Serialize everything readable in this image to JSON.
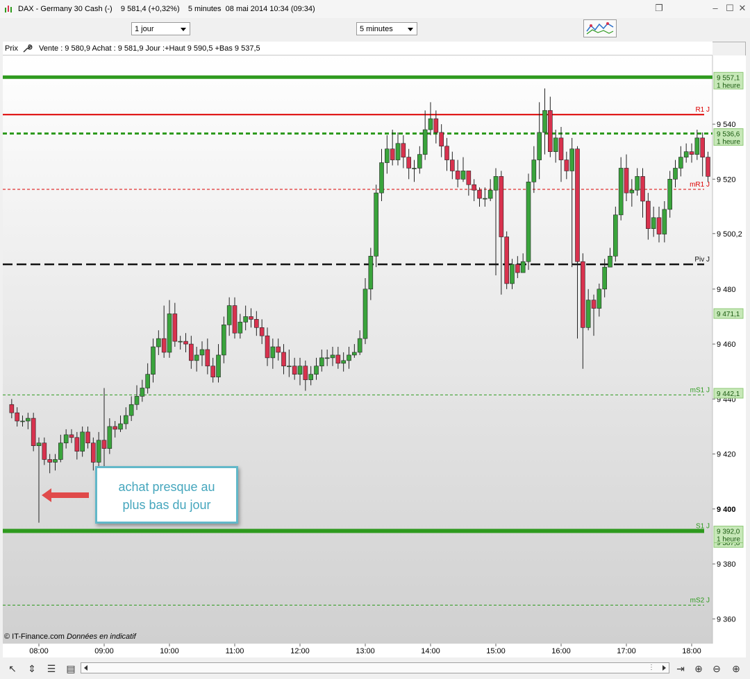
{
  "window": {
    "title": "DAX - Germany 30 Cash (-)    9 581,4 (+0,32%)    5 minutes  08 mai 2014 10:34 (09:34)",
    "controls": [
      "restore",
      "minimize",
      "maximize",
      "close"
    ]
  },
  "toolbar": {
    "period_select": "1 jour",
    "interval_select": "5 minutes"
  },
  "infobar": {
    "label": "Prix",
    "quote": "Vente : 9 580,9 Achat : 9 581,9 Jour :+Haut 9 590,5 +Bas 9 537,5"
  },
  "annotation": {
    "line1": "achat presque au",
    "line2": "plus bas du jour"
  },
  "copyright": {
    "source": "© IT-Finance.com",
    "note": "Données en indicatif"
  },
  "colors": {
    "up": "#3aa43c",
    "down": "#d8324e",
    "resistance": "#dd0000",
    "support": "#2e9a1e",
    "pivot": "#111111",
    "annotation_border": "#62b8c9",
    "annotation_text": "#45a6bd",
    "arrow": "#e04a4a"
  },
  "chart_data": {
    "type": "candlestick",
    "instrument": "DAX - Germany 30 Cash (-)",
    "interval": "5 minutes",
    "x_tick_labels": [
      "08:00",
      "09:00",
      "10:00",
      "11:00",
      "12:00",
      "13:00",
      "14:00",
      "15:00",
      "16:00",
      "17:00",
      "18:00"
    ],
    "y_tick_labels": [
      "9 360",
      "9 380",
      "9 400",
      "9 420",
      "9 440",
      "9 460",
      "9 480",
      "9 500,2",
      "9 520",
      "9 540"
    ],
    "ylim": [
      9351,
      9565
    ],
    "levels": [
      {
        "label": "R1 J",
        "value": 9543.5,
        "style": "solid",
        "color": "#dd0000"
      },
      {
        "label": "mR1 J",
        "value": 9516.3,
        "style": "dashed",
        "color": "#dd0000"
      },
      {
        "label": "Piv J",
        "value": 9489.0,
        "style": "dashed",
        "color": "#111111"
      },
      {
        "label": "mS1 J",
        "value": 9441.5,
        "style": "dashed",
        "color": "#2e9a1e"
      },
      {
        "label": "S1 J",
        "value": 9392.0,
        "style": "solid",
        "color": "#2e9a1e"
      },
      {
        "label": "mS2 J",
        "value": 9365.0,
        "style": "dashed",
        "color": "#2e9a1e"
      }
    ],
    "hour_levels": [
      {
        "value": 9557.1,
        "label": "9 557,1",
        "sub": "1 heure",
        "style": "solid"
      },
      {
        "value": 9536.6,
        "label": "9 536,6",
        "sub": "1 heure",
        "style": "dashed"
      },
      {
        "value": 9392.0,
        "label": "9 392,0",
        "sub": "1 heure",
        "style": "solid"
      }
    ],
    "price_tags": [
      {
        "value": 9471.1,
        "label": "9 471,1"
      },
      {
        "value": 9442.1,
        "label": "9 442,1"
      },
      {
        "value": 9387.8,
        "label": "9 387,8"
      }
    ],
    "series": [
      {
        "name": "DAX",
        "time": [
          "07:35",
          "07:40",
          "07:45",
          "07:50",
          "07:55",
          "08:00",
          "08:05",
          "08:10",
          "08:15",
          "08:20",
          "08:25",
          "08:30",
          "08:35",
          "08:40",
          "08:45",
          "08:50",
          "08:55",
          "09:00",
          "09:05",
          "09:10",
          "09:15",
          "09:20",
          "09:25",
          "09:30",
          "09:35",
          "09:40",
          "09:45",
          "09:50",
          "09:55",
          "10:00",
          "10:05",
          "10:10",
          "10:15",
          "10:20",
          "10:25",
          "10:30",
          "10:35",
          "10:40",
          "10:45",
          "10:50",
          "10:55",
          "11:00",
          "11:05",
          "11:10",
          "11:15",
          "11:20",
          "11:25",
          "11:30",
          "11:35",
          "11:40",
          "11:45",
          "11:50",
          "11:55",
          "12:00",
          "12:05",
          "12:10",
          "12:15",
          "12:20",
          "12:25",
          "12:30",
          "12:35",
          "12:40",
          "12:45",
          "12:50",
          "12:55",
          "13:00",
          "13:05",
          "13:10",
          "13:15",
          "13:20",
          "13:25",
          "13:30",
          "13:35",
          "13:40",
          "13:45",
          "13:50",
          "13:55",
          "14:00",
          "14:05",
          "14:10",
          "14:15",
          "14:20",
          "14:25",
          "14:30",
          "14:35",
          "14:40",
          "14:45",
          "14:50",
          "14:55",
          "15:00",
          "15:05",
          "15:10",
          "15:15",
          "15:20",
          "15:25",
          "15:30",
          "15:35",
          "15:40",
          "15:45",
          "15:50",
          "15:55",
          "16:00",
          "16:05",
          "16:10",
          "16:15",
          "16:20",
          "16:25",
          "16:30",
          "16:35",
          "16:40",
          "16:45",
          "16:50",
          "16:55",
          "17:00",
          "17:05",
          "17:10",
          "17:15",
          "17:20",
          "17:25",
          "17:30",
          "17:35",
          "17:40",
          "17:45",
          "17:50",
          "17:55",
          "18:00",
          "18:05",
          "18:10",
          "18:15"
        ],
        "open": [
          9438,
          9435,
          9432,
          9432,
          9433,
          9423,
          9424,
          9418,
          9417,
          9418,
          9424,
          9427,
          9426,
          9421,
          9428,
          9424,
          9417,
          9425,
          9422,
          9430,
          9429,
          9431,
          9434,
          9438,
          9441,
          9444,
          9449,
          9459,
          9462,
          9457,
          9471,
          9461,
          9461,
          9460,
          9454,
          9456,
          9458,
          9452,
          9448,
          9456,
          9467,
          9474,
          9464,
          9468,
          9470,
          9469,
          9466,
          9463,
          9455,
          9459,
          9457,
          9452,
          9452,
          9449,
          9452,
          9447,
          9449,
          9452,
          9455,
          9455,
          9456,
          9453,
          9454,
          9456,
          9457,
          9462,
          9480,
          9492,
          9515,
          9526,
          9531,
          9527,
          9533,
          9528,
          9524,
          9524,
          9529,
          9538,
          9542,
          9537,
          9532,
          9527,
          9523,
          9520,
          9523,
          9518,
          9516,
          9513,
          9513,
          9516,
          9521,
          9499,
          9482,
          9489,
          9486,
          9490,
          9519,
          9527,
          9537,
          9545,
          9530,
          9535,
          9527,
          9523,
          9531,
          9490,
          9466,
          9476,
          9473,
          9480,
          9488,
          9492,
          9507,
          9524,
          9515,
          9516,
          9521,
          9512,
          9502,
          9506,
          9500,
          9509,
          9520,
          9524,
          9528,
          9530,
          9529,
          9535,
          9528,
          9521,
          9525
        ],
        "close": [
          9435,
          9432,
          9432,
          9433,
          9423,
          9424,
          9418,
          9417,
          9418,
          9424,
          9427,
          9426,
          9421,
          9428,
          9424,
          9417,
          9425,
          9422,
          9430,
          9429,
          9431,
          9434,
          9438,
          9441,
          9444,
          9449,
          9459,
          9462,
          9457,
          9471,
          9461,
          9461,
          9460,
          9454,
          9456,
          9458,
          9452,
          9448,
          9456,
          9467,
          9474,
          9464,
          9468,
          9470,
          9469,
          9466,
          9463,
          9455,
          9459,
          9457,
          9452,
          9452,
          9449,
          9452,
          9447,
          9449,
          9452,
          9455,
          9455,
          9456,
          9453,
          9454,
          9456,
          9457,
          9462,
          9480,
          9492,
          9515,
          9526,
          9531,
          9527,
          9533,
          9528,
          9524,
          9524,
          9529,
          9538,
          9542,
          9537,
          9532,
          9527,
          9523,
          9520,
          9523,
          9518,
          9516,
          9513,
          9513,
          9516,
          9521,
          9499,
          9482,
          9489,
          9486,
          9490,
          9519,
          9527,
          9537,
          9545,
          9530,
          9535,
          9527,
          9523,
          9531,
          9490,
          9466,
          9476,
          9473,
          9480,
          9488,
          9492,
          9507,
          9524,
          9515,
          9516,
          9521,
          9512,
          9502,
          9506,
          9500,
          9509,
          9520,
          9524,
          9528,
          9530,
          9529,
          9535,
          9528,
          9521,
          9525,
          9530
        ],
        "high": [
          9440,
          9437,
          9434,
          9435,
          9435,
          9426,
          9426,
          9420,
          9420,
          9427,
          9429,
          9429,
          9428,
          9430,
          9430,
          9426,
          9428,
          9444,
          9433,
          9432,
          9434,
          9437,
          9441,
          9445,
          9447,
          9453,
          9462,
          9465,
          9474,
          9476,
          9475,
          9463,
          9464,
          9463,
          9459,
          9461,
          9462,
          9455,
          9460,
          9470,
          9477,
          9477,
          9471,
          9474,
          9473,
          9472,
          9469,
          9466,
          9462,
          9462,
          9460,
          9458,
          9455,
          9455,
          9454,
          9452,
          9455,
          9458,
          9458,
          9459,
          9459,
          9457,
          9459,
          9460,
          9465,
          9484,
          9495,
          9518,
          9531,
          9536,
          9538,
          9537,
          9536,
          9531,
          9527,
          9532,
          9545,
          9548,
          9545,
          9540,
          9535,
          9530,
          9527,
          9528,
          9522,
          9520,
          9517,
          9517,
          9520,
          9524,
          9523,
          9501,
          9491,
          9492,
          9493,
          9522,
          9532,
          9548,
          9553,
          9550,
          9538,
          9539,
          9530,
          9535,
          9532,
          9493,
          9480,
          9478,
          9482,
          9491,
          9495,
          9510,
          9528,
          9529,
          9520,
          9524,
          9524,
          9515,
          9510,
          9510,
          9512,
          9523,
          9527,
          9532,
          9533,
          9533,
          9538,
          9537,
          9530,
          9528,
          9534
        ],
        "low": [
          9433,
          9430,
          9430,
          9429,
          9421,
          9395,
          9416,
          9413,
          9414,
          9417,
          9422,
          9424,
          9418,
          9419,
          9422,
          9414,
          9414,
          9409,
          9420,
          9426,
          9428,
          9429,
          9432,
          9436,
          9439,
          9442,
          9446,
          9456,
          9455,
          9455,
          9459,
          9458,
          9457,
          9451,
          9450,
          9452,
          9449,
          9446,
          9446,
          9453,
          9463,
          9462,
          9462,
          9465,
          9466,
          9463,
          9460,
          9452,
          9451,
          9454,
          9449,
          9448,
          9447,
          9445,
          9443,
          9445,
          9447,
          9450,
          9452,
          9452,
          9451,
          9450,
          9451,
          9455,
          9456,
          9460,
          9476,
          9488,
          9512,
          9522,
          9525,
          9525,
          9524,
          9520,
          9519,
          9522,
          9527,
          9536,
          9533,
          9528,
          9523,
          9520,
          9517,
          9519,
          9514,
          9512,
          9510,
          9510,
          9512,
          9485,
          9478,
          9480,
          9480,
          9484,
          9486,
          9487,
          9515,
          9520,
          9529,
          9528,
          9526,
          9519,
          9520,
          9488,
          9462,
          9451,
          9465,
          9463,
          9470,
          9477,
          9488,
          9490,
          9505,
          9512,
          9510,
          9514,
          9506,
          9498,
          9499,
          9497,
          9497,
          9506,
          9517,
          9521,
          9526,
          9526,
          9527,
          9521,
          9519,
          9519,
          9523
        ]
      }
    ],
    "grid": false,
    "title": "",
    "xlabel": "",
    "ylabel": ""
  }
}
